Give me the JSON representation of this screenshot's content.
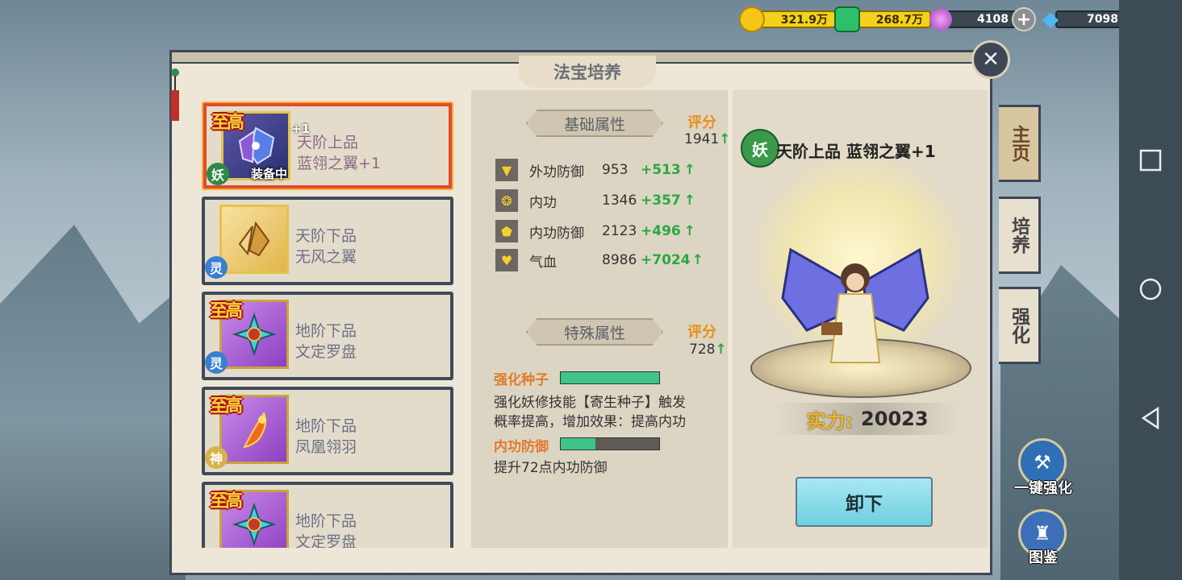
{
  "currencies": [
    {
      "icon": "gold-coin-icon",
      "value": "321.9万",
      "style": "gold"
    },
    {
      "icon": "green-gem-icon",
      "value": "268.7万",
      "style": "gold"
    },
    {
      "icon": "purple-orb-icon",
      "value": "4108",
      "style": "dark"
    },
    {
      "icon": "diamond-icon",
      "value": "7098",
      "style": "dark"
    }
  ],
  "panel": {
    "title": "法宝培养"
  },
  "items": [
    {
      "grade_badge": "至高",
      "name1": "天阶上品",
      "name2": "蓝翎之翼+1",
      "type_badge": "妖",
      "equipped_label": "装备中",
      "plus": "+1",
      "frame": "blue",
      "selected": true
    },
    {
      "grade_badge": "",
      "name1": "天阶下品",
      "name2": "无风之翼",
      "type_badge": "灵",
      "frame": "gold",
      "selected": false
    },
    {
      "grade_badge": "至高",
      "name1": "地阶下品",
      "name2": "文定罗盘",
      "type_badge": "灵",
      "frame": "purple",
      "selected": false
    },
    {
      "grade_badge": "至高",
      "name1": "地阶下品",
      "name2": "凤凰翎羽",
      "type_badge": "神",
      "frame": "purple",
      "selected": false
    },
    {
      "grade_badge": "至高",
      "name1": "地阶下品",
      "name2": "文定罗盘",
      "type_badge": "",
      "frame": "purple",
      "selected": false
    }
  ],
  "base": {
    "header": "基础属性",
    "score_label": "评分",
    "score_value": "1941",
    "stats": [
      {
        "icon": "armor-icon",
        "name": "外功防御",
        "value": "953",
        "inc": "+513"
      },
      {
        "icon": "staff-icon",
        "name": "内功",
        "value": "1346",
        "inc": "+357"
      },
      {
        "icon": "shield-icon",
        "name": "内功防御",
        "value": "2123",
        "inc": "+496"
      },
      {
        "icon": "heart-icon",
        "name": "气血",
        "value": "8986",
        "inc": "+7024"
      }
    ]
  },
  "special": {
    "header": "特殊属性",
    "score_label": "评分",
    "score_value": "728",
    "attr1_name": "强化种子",
    "attr1_progress": 1.0,
    "attr1_desc1": "强化妖修技能【寄生种子】触发",
    "attr1_desc2": "概率提高，增加效果：提高内功",
    "attr2_name": "内功防御",
    "attr2_progress": 0.35,
    "attr2_desc": "提升72点内功防御"
  },
  "detail": {
    "emblem": "妖",
    "title": "天阶上品 蓝翎之翼+1",
    "power_label": "实力:",
    "power_value": "20023",
    "unequip_label": "卸下"
  },
  "tabs": [
    "主页",
    "培养",
    "强化"
  ],
  "actions": {
    "enhance_label": "一键强化",
    "codex_label": "图鉴"
  }
}
